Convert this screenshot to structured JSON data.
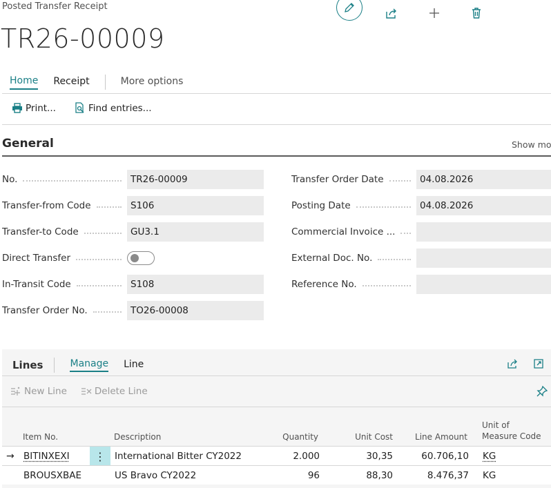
{
  "page": {
    "breadcrumb": "Posted Transfer Receipt",
    "title": "TR26-00009"
  },
  "top_actions": [
    "edit-icon",
    "share-icon",
    "add-icon",
    "delete-icon"
  ],
  "tabs": {
    "home": "Home",
    "receipt": "Receipt",
    "more": "More options"
  },
  "actions": {
    "print": "Print...",
    "find_entries": "Find entries..."
  },
  "general": {
    "title": "General",
    "show_more": "Show more",
    "fields": {
      "no": {
        "label": "No.",
        "value": "TR26-00009"
      },
      "transfer_from": {
        "label": "Transfer-from Code",
        "value": "S106"
      },
      "transfer_to": {
        "label": "Transfer-to Code",
        "value": "GU3.1"
      },
      "direct_transfer": {
        "label": "Direct Transfer",
        "value": false
      },
      "in_transit": {
        "label": "In-Transit Code",
        "value": "S108"
      },
      "transfer_order_no": {
        "label": "Transfer Order No.",
        "value": "TO26-00008"
      },
      "transfer_order_date": {
        "label": "Transfer Order Date",
        "value": "04.08.2026"
      },
      "posting_date": {
        "label": "Posting Date",
        "value": "04.08.2026"
      },
      "commercial_invoice": {
        "label": "Commercial Invoice ...",
        "value": ""
      },
      "external_doc": {
        "label": "External Doc. No.",
        "value": ""
      },
      "reference_no": {
        "label": "Reference No.",
        "value": ""
      }
    }
  },
  "lines": {
    "title": "Lines",
    "tabs": {
      "manage": "Manage",
      "line": "Line"
    },
    "actions": {
      "new_line": "New Line",
      "delete_line": "Delete Line"
    },
    "columns": {
      "item_no": "Item No.",
      "description": "Description",
      "quantity": "Quantity",
      "unit_cost": "Unit Cost",
      "line_amount": "Line Amount",
      "uom_1": "Unit of",
      "uom_2": "Measure Code"
    },
    "rows": [
      {
        "item_no": "BITINXEXI",
        "description": "International Bitter CY2022",
        "quantity": "2.000",
        "unit_cost": "30,35",
        "line_amount": "60.706,10",
        "uom": "KG"
      },
      {
        "item_no": "BROUSXBAE",
        "description": "US Bravo CY2022",
        "quantity": "96",
        "unit_cost": "88,30",
        "line_amount": "8.476,37",
        "uom": "KG"
      }
    ]
  },
  "colors": {
    "accent": "#1a7f86",
    "field_bg": "#ebebeb",
    "selected_cell": "#b8e6ea"
  }
}
